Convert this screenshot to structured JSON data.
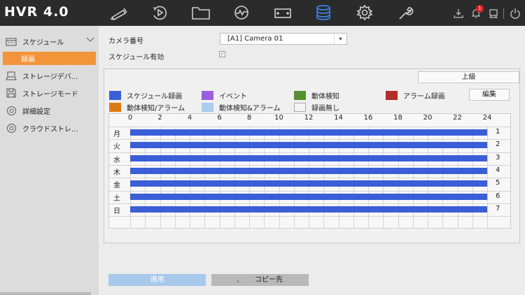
{
  "app": {
    "title": "HVR 4.0"
  },
  "topnav": {
    "icons": [
      "camera-icon",
      "playback-icon",
      "folder-icon",
      "analytics-icon",
      "video-camera-icon",
      "storage-icon",
      "settings-icon",
      "tools-icon"
    ],
    "active": "storage-icon",
    "notification_count": "1"
  },
  "sidebar": {
    "schedule_label": "スケジュール",
    "record_label": "録画",
    "items": [
      "ストレージデバ...",
      "ストレージモード",
      "詳細設定",
      "クラウドストレ..."
    ]
  },
  "form": {
    "camera_label": "カメラ番号",
    "camera_value": "[A1] Camera 01",
    "schedule_enable_label": "スケジュール有効",
    "schedule_enabled": true
  },
  "panel": {
    "advanced_button": "上級",
    "edit_button": "編集",
    "legend": [
      {
        "label": "スケジュール録画",
        "color": "#3a5ed8"
      },
      {
        "label": "イベント",
        "color": "#9c5ee0"
      },
      {
        "label": "動体検知",
        "color": "#57912f"
      },
      {
        "label": "アラーム録画",
        "color": "#b62b2b"
      },
      {
        "label": "動体検知/アラーム",
        "color": "#dc7a12"
      },
      {
        "label": "動体検知&アラーム",
        "color": "#a9cdee"
      },
      {
        "label": "録画無し",
        "color": "#f5f5f5"
      }
    ],
    "hour_ticks": [
      "0",
      "2",
      "4",
      "6",
      "8",
      "10",
      "12",
      "14",
      "16",
      "18",
      "20",
      "22",
      "24"
    ],
    "days": [
      {
        "label": "月",
        "num": "1"
      },
      {
        "label": "火",
        "num": "2"
      },
      {
        "label": "水",
        "num": "3"
      },
      {
        "label": "木",
        "num": "4"
      },
      {
        "label": "金",
        "num": "5"
      },
      {
        "label": "土",
        "num": "6"
      },
      {
        "label": "日",
        "num": "7"
      }
    ]
  },
  "footer": {
    "apply_button": "適用",
    "copy_button": "コピー先"
  }
}
